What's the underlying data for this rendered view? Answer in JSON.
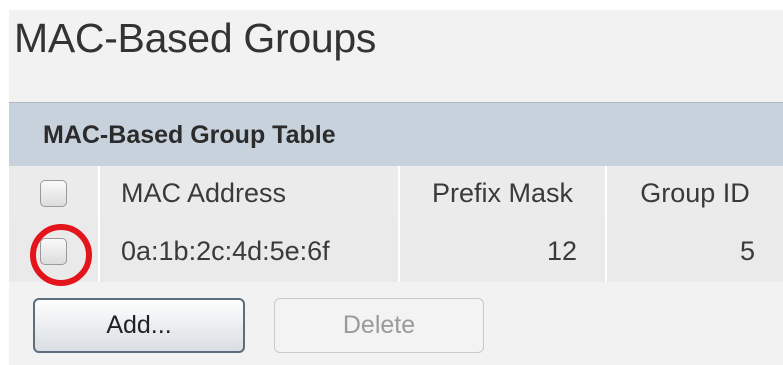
{
  "page": {
    "title": "MAC-Based Groups"
  },
  "table": {
    "title": "MAC-Based Group Table",
    "columns": {
      "mac_address": "MAC Address",
      "prefix_mask": "Prefix Mask",
      "group_id": "Group ID"
    },
    "rows": [
      {
        "mac_address": "0a:1b:2c:4d:5e:6f",
        "prefix_mask": "12",
        "group_id": "5",
        "selected": false
      }
    ]
  },
  "actions": {
    "add_label": "Add...",
    "delete_label": "Delete",
    "delete_enabled": false
  },
  "colors": {
    "table_header_bg": "#c7d2dc",
    "row_bg": "#ebebeb",
    "highlight_ring": "#e3141b",
    "disabled_text": "#9a9a9a"
  }
}
